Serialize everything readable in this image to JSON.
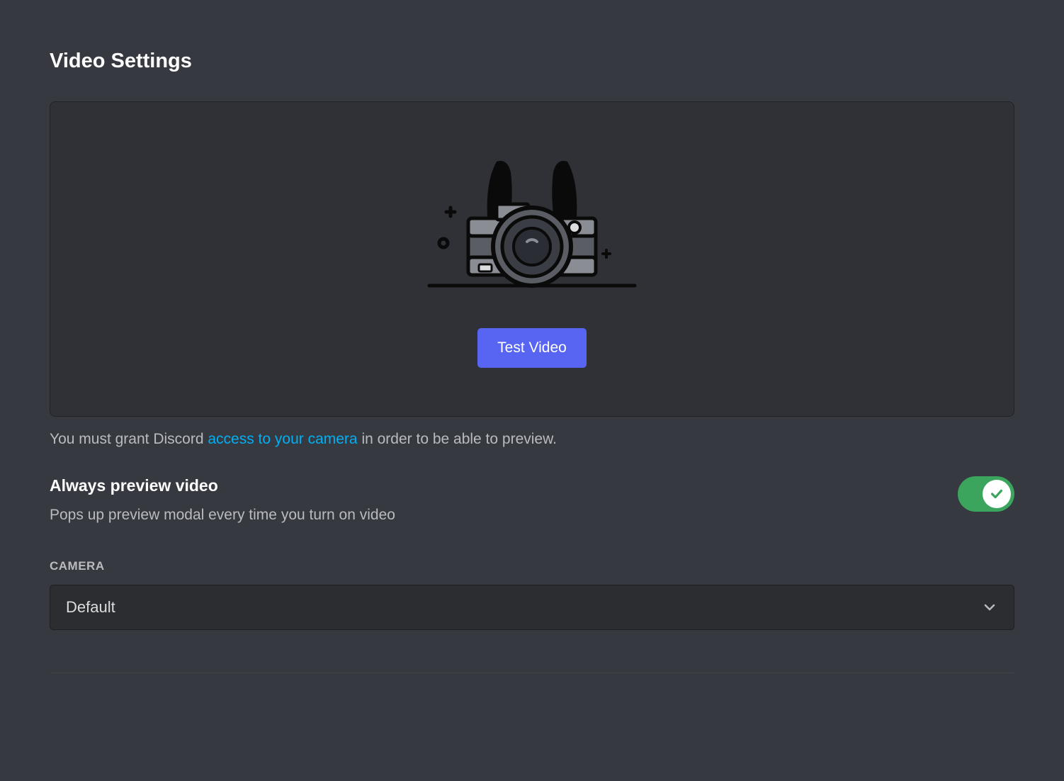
{
  "title": "Video Settings",
  "test_button_label": "Test Video",
  "info": {
    "prefix": "You must grant Discord ",
    "link": "access to your camera",
    "suffix": " in order to be able to preview."
  },
  "toggle": {
    "label": "Always preview video",
    "description": "Pops up preview modal every time you turn on video",
    "enabled": true
  },
  "camera": {
    "section_label": "CAMERA",
    "selected": "Default"
  },
  "colors": {
    "accent": "#5865f2",
    "toggle_on": "#3ba55d",
    "link": "#00aff4"
  }
}
